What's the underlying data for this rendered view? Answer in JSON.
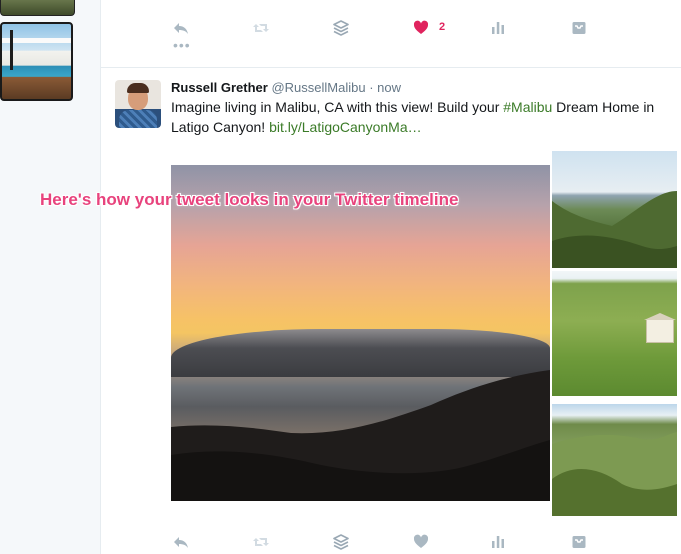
{
  "tweet_above": {
    "like_count": "2",
    "more_label": "•••"
  },
  "tweet": {
    "display_name": "Russell Grether",
    "handle": "@RussellMalibu",
    "separator": "·",
    "time": "now",
    "text_before": "Imagine living in Malibu, CA with this view! Build your ",
    "hashtag": "#Malibu",
    "text_middle": " Dream Home in Latigo Canyon! ",
    "link": "bit.ly/LatigoCanyonMa…"
  },
  "overlay_caption": "Here's how your tweet looks in your Twitter timeline",
  "icons": [
    "reply-icon",
    "retweet-icon",
    "buffer-icon",
    "heart-icon",
    "analytics-icon",
    "inbox-icon"
  ],
  "colors": {
    "like_active": "#e0245e",
    "link": "#3b7b28",
    "icon_gray": "#aab8c2",
    "caption": "#e8437d"
  }
}
